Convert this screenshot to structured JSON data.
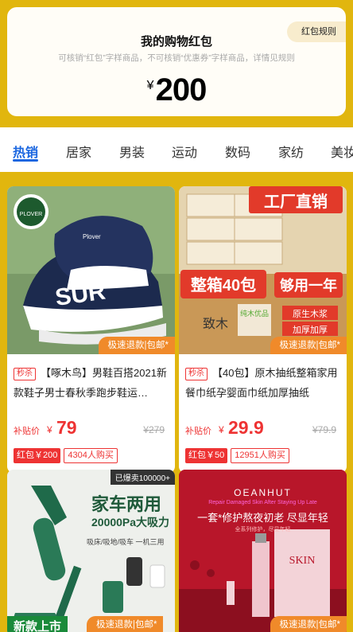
{
  "redpacket": {
    "title": "我的购物红包",
    "subtitle": "可核销“红包”字样商品，不可核销“优惠券”字样商品，详情见规则",
    "currency": "¥",
    "amount": "200",
    "rules_label": "红包规则"
  },
  "tabs": [
    "热销",
    "居家",
    "男装",
    "运动",
    "数码",
    "家纺",
    "美妆"
  ],
  "products": [
    {
      "brand_text": "PLOVER",
      "image_caption": "Plover",
      "refund_tag": "极速退款|包邮*",
      "seckill_label": "秒杀",
      "title": "【啄木鸟】男鞋百搭2021新款鞋子男士春秋季跑步鞋运…",
      "subsidy_label": "补贴价",
      "currency": "¥",
      "price": "79",
      "original_price": "¥279",
      "redpacket_badge": "红包￥200",
      "buyers": "4304人购买"
    },
    {
      "banner1": "工厂直销",
      "banner2": "整箱40包",
      "banner3": "够用一年",
      "tag_a": "致木",
      "tag_b": "纯木优品",
      "tag_c": "原生木浆",
      "tag_d": "加厚加厚",
      "refund_tag": "极速退款|包邮*",
      "seckill_label": "秒杀",
      "title": "【40包】原木抽纸整箱家用餐巾纸孕婴面巾纸加厚抽纸",
      "subsidy_label": "补贴价",
      "currency": "¥",
      "price": "29.9",
      "original_price": "¥79.9",
      "redpacket_badge": "红包￥50",
      "buyers": "12951人购买"
    },
    {
      "hot_label": "已爆卖100000+",
      "heading": "家车两用",
      "subheading": "20000Pa大吸力",
      "features": "吸床/吸地/吸车  一机三用",
      "new_label": "新款上市",
      "refund_tag": "极速退款|包邮*"
    },
    {
      "logo": "OEANHUT",
      "logo_sub": "Repair Damaged Skin After Staying Up Late",
      "slogan": "一套*修护熬夜初老 尽显年轻",
      "small_text": "全系列修护，尽显年轻",
      "box_text": "SKIN",
      "refund_tag": "极速退款|包邮*"
    }
  ],
  "colors": {
    "accent_blue": "#1a66e0",
    "price_red": "#e33333",
    "refund_orange": "#f08a2a",
    "background_gold": "#e1b60e"
  }
}
